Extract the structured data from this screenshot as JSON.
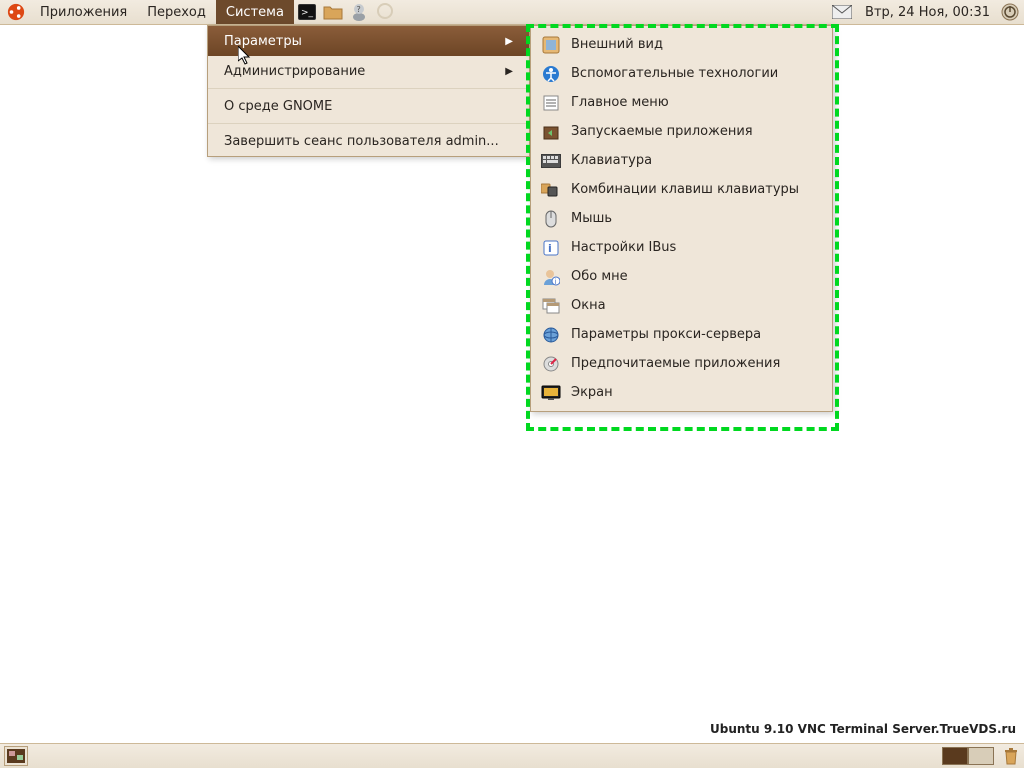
{
  "top_panel": {
    "menus": {
      "applications": "Приложения",
      "places": "Переход",
      "system": "Система"
    },
    "clock": "Втр, 24 Ноя, 00:31"
  },
  "system_menu": {
    "preferences": "Параметры",
    "administration": "Администрирование",
    "about_gnome": "О среде GNOME",
    "logout": "Завершить сеанс пользователя admin..."
  },
  "preferences_submenu": {
    "items": [
      {
        "label": "Внешний вид"
      },
      {
        "label": "Вспомогательные технологии"
      },
      {
        "label": "Главное меню"
      },
      {
        "label": "Запускаемые приложения"
      },
      {
        "label": "Клавиатура"
      },
      {
        "label": "Комбинации клавиш клавиатуры"
      },
      {
        "label": "Мышь"
      },
      {
        "label": "Настройки IBus"
      },
      {
        "label": "Обо мне"
      },
      {
        "label": "Окна"
      },
      {
        "label": "Параметры прокси-сервера"
      },
      {
        "label": "Предпочитаемые приложения"
      },
      {
        "label": "Экран"
      }
    ]
  },
  "watermark": "Ubuntu 9.10 VNC Terminal Server.TrueVDS.ru"
}
